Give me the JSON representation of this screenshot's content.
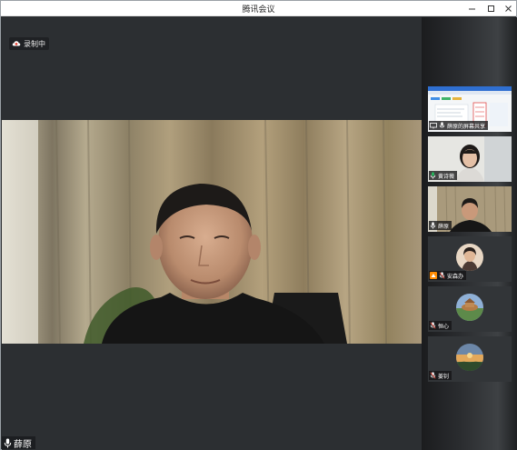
{
  "window": {
    "title": "腾讯会议"
  },
  "recording": {
    "label": "录制中",
    "icon": "cloud-record-icon",
    "color": "#e84a3c"
  },
  "main_speaker": {
    "name": "薛原",
    "icon": "microphone-icon"
  },
  "participants": [
    {
      "name": "薛原的屏幕共享",
      "icon": "screen-share-icon"
    },
    {
      "name": "黄诗薇",
      "icon": "microphone-speaking-icon"
    },
    {
      "name": "薛原",
      "icon": "microphone-icon"
    },
    {
      "name": "安森办",
      "icon": "microphone-muted-icon"
    },
    {
      "name": "恒心",
      "icon": "microphone-muted-icon"
    },
    {
      "name": "姜钊",
      "icon": "microphone-muted-icon"
    }
  ],
  "colors": {
    "speaking": "#22c55e",
    "share_badge": "#ff8a00",
    "muted": "#e84a3c"
  }
}
